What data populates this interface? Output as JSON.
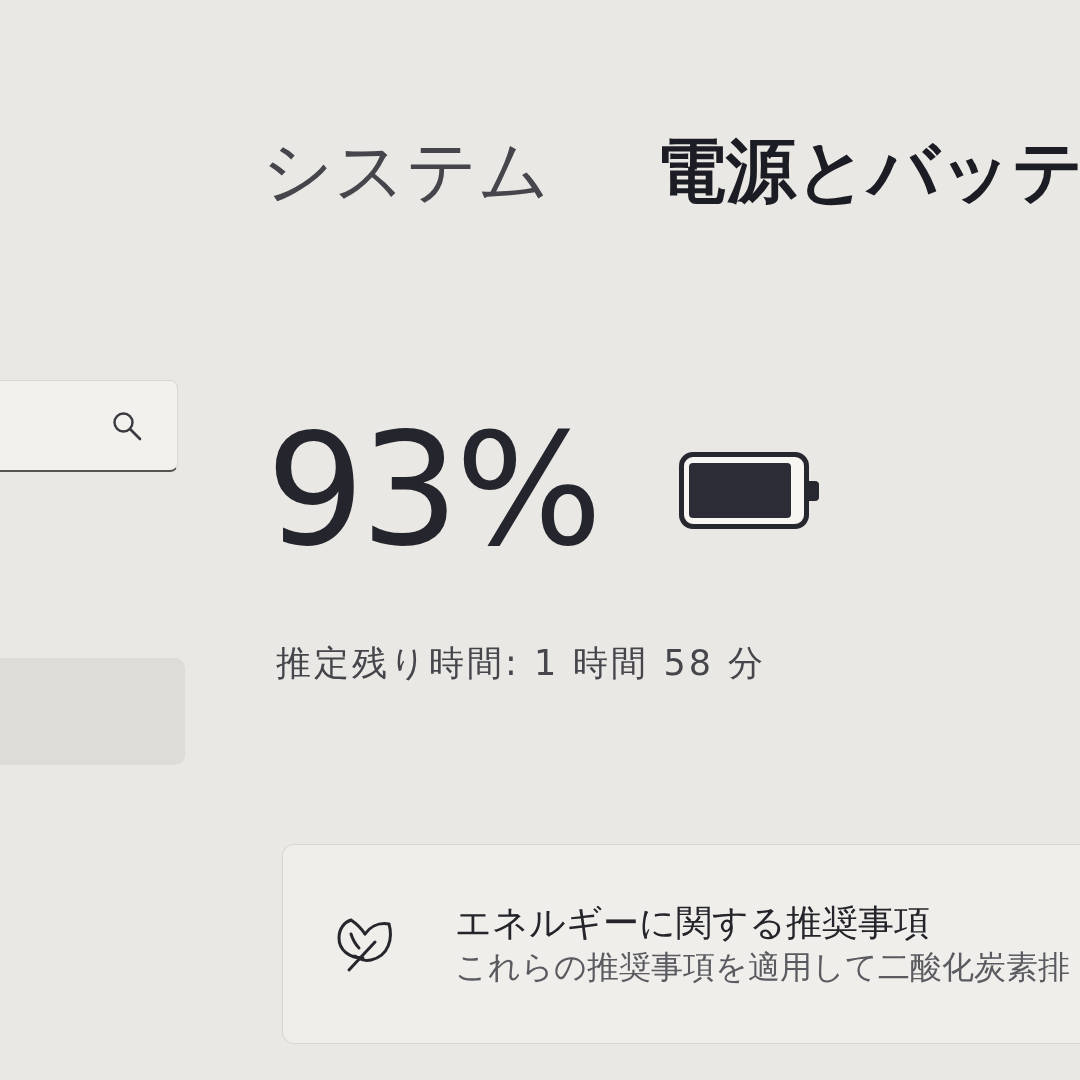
{
  "breadcrumb": {
    "parent": "システム",
    "current": "電源とバッテ"
  },
  "sidebar": {
    "items": [
      {
        "selected": true
      }
    ]
  },
  "battery": {
    "percentage": "93%",
    "level": 0.93,
    "estimate": "推定残り時間: 1 時間 58 分"
  },
  "cards": [
    {
      "title": "エネルギーに関する推奨事項",
      "description": "これらの推奨事項を適用して二酸化炭素排"
    }
  ]
}
